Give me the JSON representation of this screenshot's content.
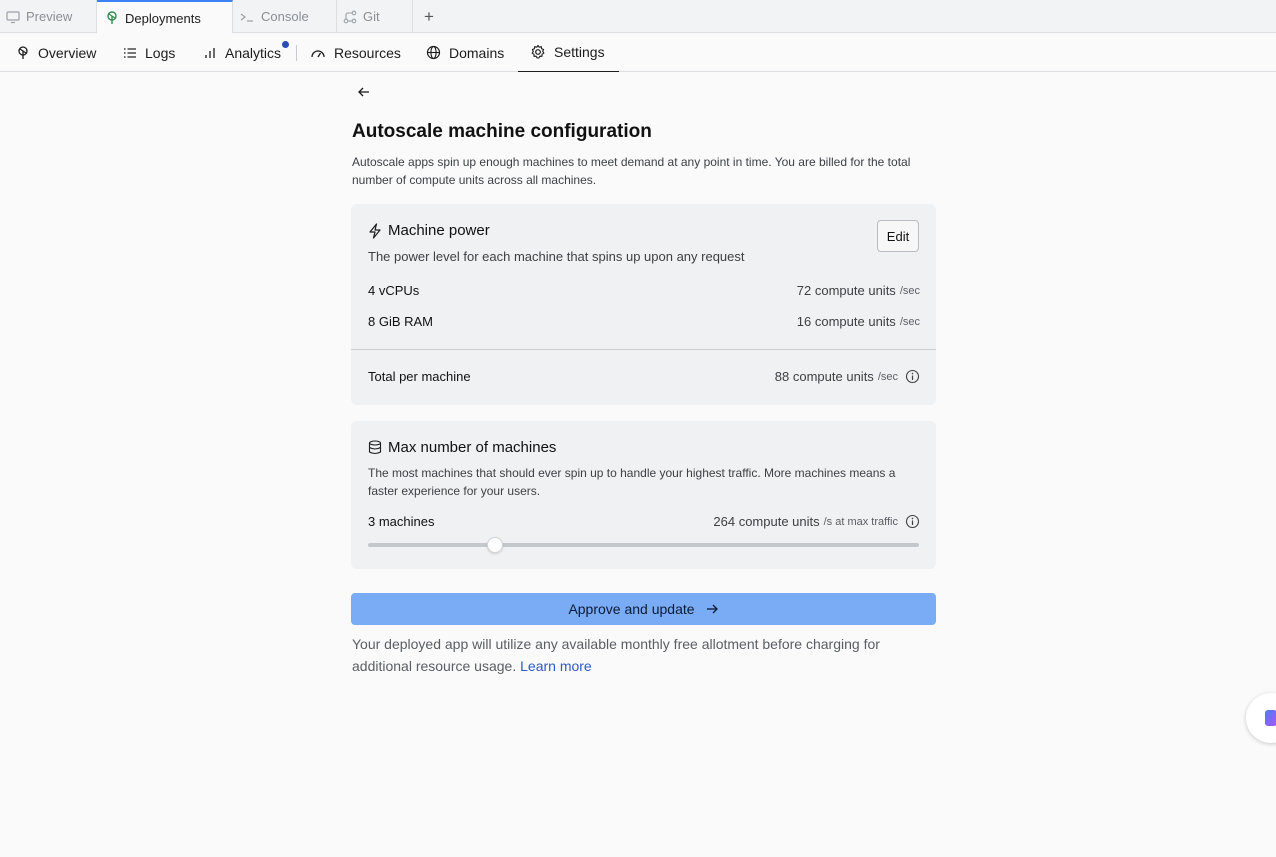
{
  "tabs": [
    {
      "label": "Preview",
      "icon": "monitor-icon"
    },
    {
      "label": "Deployments",
      "icon": "deployments-icon"
    },
    {
      "label": "Console",
      "icon": "terminal-icon"
    },
    {
      "label": "Git",
      "icon": "git-icon"
    }
  ],
  "add_tab": "+",
  "nav": [
    {
      "label": "Overview",
      "icon": "deployments-icon"
    },
    {
      "label": "Logs",
      "icon": "list-icon"
    },
    {
      "label": "Analytics",
      "icon": "bar-chart-icon"
    },
    {
      "label": "Resources",
      "icon": "gauge-icon"
    },
    {
      "label": "Domains",
      "icon": "globe-icon"
    },
    {
      "label": "Settings",
      "icon": "gear-icon"
    }
  ],
  "page": {
    "title": "Autoscale machine configuration",
    "subtitle": "Autoscale apps spin up enough machines to meet demand at any point in time. You are billed for the total number of compute units across all machines."
  },
  "machine_power": {
    "title": "Machine power",
    "edit_label": "Edit",
    "description": "The power level for each machine that spins up upon any request",
    "rows": [
      {
        "label": "4 vCPUs",
        "value": "72 compute units",
        "unit": "/sec"
      },
      {
        "label": "8 GiB RAM",
        "value": "16 compute units",
        "unit": "/sec"
      }
    ],
    "total_label": "Total per machine",
    "total_value": "88 compute units",
    "total_unit": "/sec"
  },
  "max_machines": {
    "title": "Max number of machines",
    "description": "The most machines that should ever spin up to handle your highest traffic. More machines means a faster experience for your users.",
    "count_label": "3 machines",
    "value": "264 compute units",
    "unit": "/s at max traffic",
    "slider_fraction": 0.23
  },
  "approve_label": "Approve and update",
  "footer": {
    "text": "Your deployed app will utilize any available monthly free allotment before charging for additional resource usage.",
    "link": "Learn more"
  },
  "colors": {
    "accent": "#7aacf5",
    "link": "#2c5bc7",
    "tab_active": "#3b82f6",
    "notification_dot": "#2b4bb5"
  }
}
